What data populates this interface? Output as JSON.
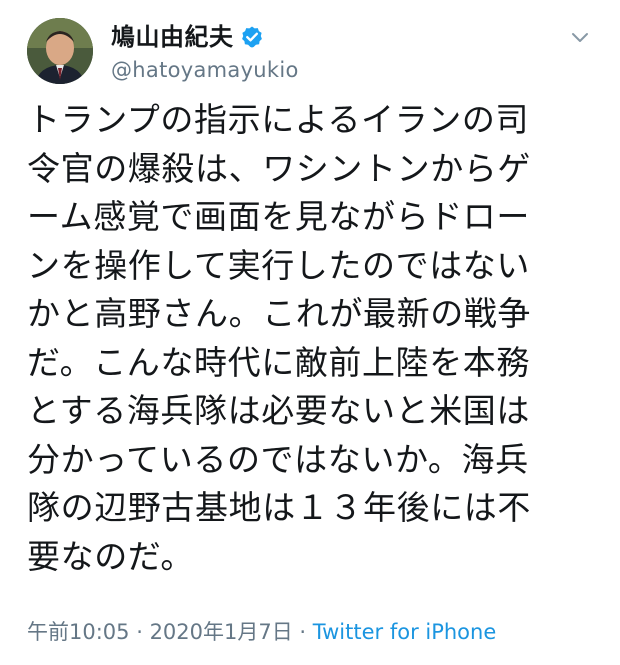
{
  "tweet": {
    "display_name": "鳩山由紀夫",
    "handle": "@hatoyamayukio",
    "verified": true,
    "menu_icon": "chevron-down-icon",
    "text_lines": [
      "トランプの指示によるイランの司",
      "令官の爆殺は、ワシントンからゲ",
      "ーム感覚で画面を見ながらドロー",
      "ンを操作して実行したのではない",
      "かと高野さん。これが最新の戦争",
      "だ。こんな時代に敵前上陸を本務",
      "とする海兵隊は必要ないと米国は",
      "分かっているのではないか。海兵",
      "隊の辺野古基地は１３年後には不",
      "要なのだ。"
    ],
    "time": "午前10:05",
    "separator1": " · ",
    "date": "2020年1月7日",
    "separator2": " · ",
    "source": "Twitter for iPhone"
  },
  "colors": {
    "text": "#14171a",
    "secondary": "#657786",
    "link": "#1b95e0",
    "verified_badge": "#1da1f2"
  }
}
